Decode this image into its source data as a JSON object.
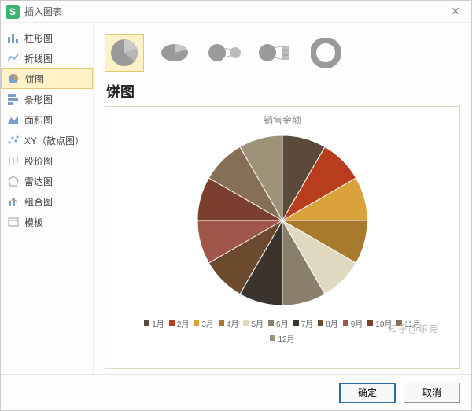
{
  "dialog": {
    "title": "插入图表",
    "app_icon_letter": "S"
  },
  "sidebar": {
    "items": [
      {
        "label": "柱形图"
      },
      {
        "label": "折线图"
      },
      {
        "label": "饼图"
      },
      {
        "label": "条形图"
      },
      {
        "label": "面积图"
      },
      {
        "label": "XY（散点图）"
      },
      {
        "label": "股价图"
      },
      {
        "label": "雷达图"
      },
      {
        "label": "组合图"
      },
      {
        "label": "模板"
      }
    ],
    "selected_index": 2
  },
  "subtype": {
    "selected_index": 0
  },
  "main": {
    "heading": "饼图"
  },
  "chart_data": {
    "type": "pie",
    "title": "销售金额",
    "categories": [
      "1月",
      "2月",
      "3月",
      "4月",
      "5月",
      "6月",
      "7月",
      "8月",
      "9月",
      "10月",
      "11月",
      "12月"
    ],
    "values": [
      8.3,
      8.3,
      8.3,
      8.3,
      8.3,
      8.3,
      8.3,
      8.3,
      8.3,
      8.3,
      8.3,
      8.3
    ],
    "colors": [
      "#5b4a3a",
      "#b83d1e",
      "#d9a23a",
      "#a77a2e",
      "#e0d9c0",
      "#8a7f6a",
      "#3b342c",
      "#6b4a2e",
      "#a0564a",
      "#7a3f2e",
      "#876f57",
      "#9e9279"
    ]
  },
  "footer": {
    "ok": "确定",
    "cancel": "取消"
  },
  "watermark": "知乎@嘛克"
}
